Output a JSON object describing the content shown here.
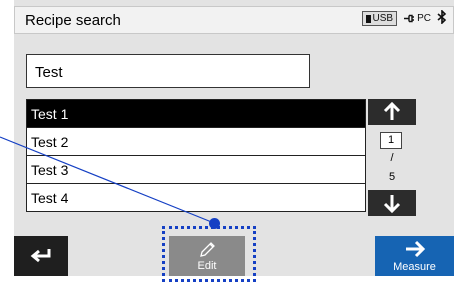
{
  "header": {
    "title": "Recipe search",
    "usb_label": "USB",
    "pc_label": "PC"
  },
  "search": {
    "value": "Test"
  },
  "list": {
    "items": [
      "Test 1",
      "Test 2",
      "Test 3",
      "Test 4"
    ],
    "selected_index": 0
  },
  "pager": {
    "current": "1",
    "separator": "/",
    "total": "5"
  },
  "footer": {
    "edit_label": "Edit",
    "measure_label": "Measure"
  },
  "colors": {
    "accent": "#1664b3",
    "annotation": "#1540c4",
    "header_bar": "#f2f2f2",
    "panel": "#e3e3e3"
  }
}
